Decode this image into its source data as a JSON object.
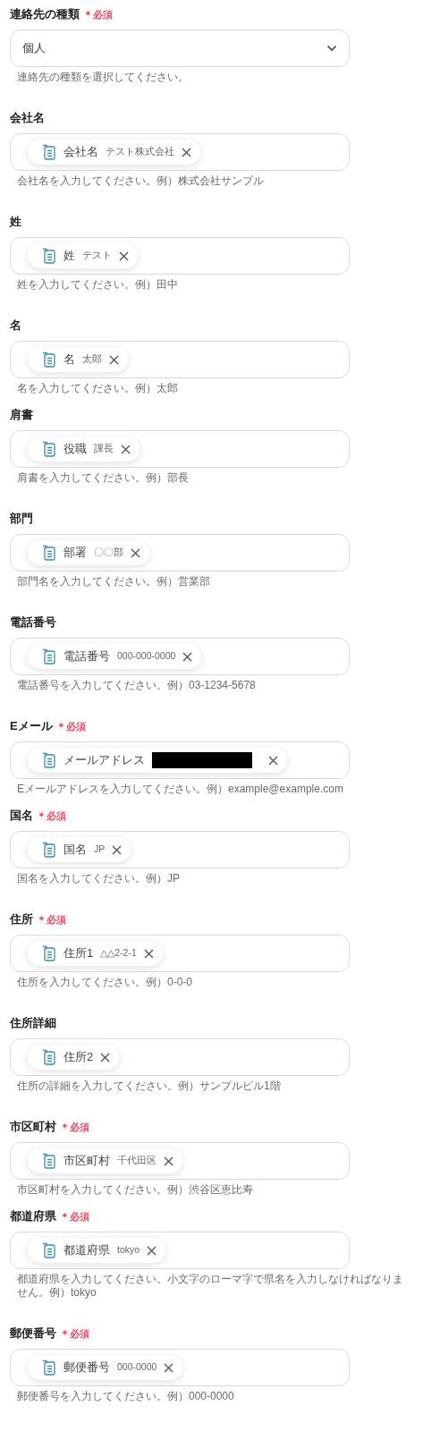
{
  "fields": [
    {
      "kind": "select",
      "label": "連絡先の種類",
      "required_text": "＊必須",
      "value": "個人",
      "help": "連絡先の種類を選択してください。"
    },
    {
      "kind": "chip",
      "label": "会社名",
      "chip": {
        "name": "会社名",
        "value": "テスト株式会社"
      },
      "help": "会社名を入力してください。例）株式会社サンプル"
    },
    {
      "kind": "chip",
      "label": "姓",
      "chip": {
        "name": "姓",
        "value": "テスト"
      },
      "help": "姓を入力してください。例）田中"
    },
    {
      "kind": "chip",
      "label": "名",
      "chip": {
        "name": "名",
        "value": "太郎"
      },
      "help": "名を入力してください。例）太郎"
    },
    {
      "kind": "chip",
      "label": "肩書",
      "chip": {
        "name": "役職",
        "value": "課長"
      },
      "help": "肩書を入力してください。例）部長"
    },
    {
      "kind": "chip",
      "label": "部門",
      "chip": {
        "name": "部署",
        "value": "〇〇部"
      },
      "help": "部門名を入力してください。例）営業部"
    },
    {
      "kind": "chip",
      "label": "電話番号",
      "chip": {
        "name": "電話番号",
        "value": "000-000-0000"
      },
      "help": "電話番号を入力してください。例）03-1234-5678"
    },
    {
      "kind": "chip",
      "label": "Eメール",
      "required_text": "＊必須",
      "chip": {
        "name": "メールアドレス",
        "redacted": true
      },
      "help": "Eメールアドレスを入力してください。例）example@example.com"
    },
    {
      "kind": "chip",
      "label": "国名",
      "required_text": "＊必須",
      "chip": {
        "name": "国名",
        "value": "JP"
      },
      "help": "国名を入力してください。例）JP"
    },
    {
      "kind": "chip",
      "label": "住所",
      "required_text": "＊必須",
      "chip": {
        "name": "住所1",
        "value": "△△2-2-1"
      },
      "help": "住所を入力してください。例）0-0-0"
    },
    {
      "kind": "chip",
      "label": "住所詳細",
      "chip": {
        "name": "住所2"
      },
      "help": "住所の詳細を入力してください。例）サンプルビル1階"
    },
    {
      "kind": "chip",
      "label": "市区町村",
      "required_text": "＊必須",
      "chip": {
        "name": "市区町村",
        "value": "千代田区"
      },
      "help": "市区町村を入力してください。例）渋谷区恵比寿"
    },
    {
      "kind": "chip",
      "label": "都道府県",
      "required_text": "＊必須",
      "chip": {
        "name": "都道府県",
        "value": "tokyo"
      },
      "help": "都道府県を入力してください。小文字のローマ字で県名を入力しなければなりません。例）tokyo"
    },
    {
      "kind": "chip",
      "label": "郵便番号",
      "required_text": "＊必須",
      "chip": {
        "name": "郵便番号",
        "value": "000-0000"
      },
      "help": "郵便番号を入力してください。例）000-0000"
    }
  ]
}
